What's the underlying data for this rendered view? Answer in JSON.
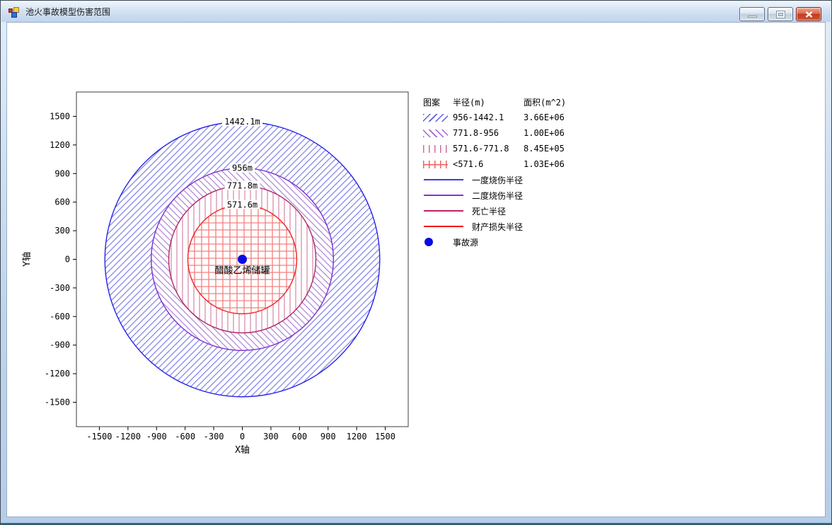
{
  "window": {
    "title": "池火事故模型伤害范围",
    "buttons": {
      "minimize": "minimize",
      "maximize": "maximize",
      "close": "close"
    }
  },
  "chart": {
    "x_axis": {
      "label": "X轴",
      "ticks": [
        -1500,
        -1200,
        -900,
        -600,
        -300,
        0,
        300,
        600,
        900,
        1200,
        1500
      ]
    },
    "y_axis": {
      "label": "Y轴",
      "ticks": [
        -1500,
        -1200,
        -900,
        -600,
        -300,
        0,
        300,
        600,
        900,
        1200,
        1500
      ]
    },
    "rings": [
      {
        "label": "1442.1m",
        "radius_m": 1442.1,
        "stroke": "#2525e8",
        "hatch": "diag-forward",
        "hatch_color": "#8585ea"
      },
      {
        "label": "956m",
        "radius_m": 956,
        "stroke": "#7c2fd0",
        "hatch": "diag-back",
        "hatch_color": "#b08ad6"
      },
      {
        "label": "771.8m",
        "radius_m": 771.8,
        "stroke": "#b02866",
        "hatch": "vertical",
        "hatch_color": "#d98fae"
      },
      {
        "label": "571.6m",
        "radius_m": 571.6,
        "stroke": "#ee2424",
        "hatch": "cross",
        "hatch_color": "#f28080"
      }
    ],
    "source": {
      "label": "醋酸乙烯储罐",
      "color": "#0a0ae6"
    }
  },
  "legend": {
    "headers": [
      "图案",
      "半径(m)",
      "面积(m^2)"
    ],
    "pattern_rows": [
      {
        "pattern": "diag-forward",
        "color": "#5c5ce2",
        "radius": "956-1442.1",
        "area": "3.66E+06"
      },
      {
        "pattern": "diag-back",
        "color": "#a263cc",
        "radius": "771.8-956",
        "area": "1.00E+06"
      },
      {
        "pattern": "vertical",
        "color": "#cf6f9e",
        "radius": "571.6-771.8",
        "area": "8.45E+05"
      },
      {
        "pattern": "cross",
        "color": "#ef6161",
        "radius": "<571.6",
        "area": "1.03E+06"
      }
    ],
    "line_rows": [
      {
        "color": "#3a3ae8",
        "label": "一度烧伤半径"
      },
      {
        "color": "#8833cc",
        "label": "二度烧伤半径"
      },
      {
        "color": "#c12069",
        "label": "死亡半径"
      },
      {
        "color": "#f21515",
        "label": "财产损失半径"
      }
    ],
    "source_row": {
      "color": "#0a0ae6",
      "label": "事故源"
    }
  },
  "chart_data": {
    "type": "area",
    "title": "池火事故模型伤害范围",
    "xlabel": "X轴",
    "ylabel": "Y轴",
    "xlim": [
      -1740,
      1740
    ],
    "ylim": [
      -1755,
      1755
    ],
    "x_ticks": [
      -1500,
      -1200,
      -900,
      -600,
      -300,
      0,
      300,
      600,
      900,
      1200,
      1500
    ],
    "y_ticks": [
      -1500,
      -1200,
      -900,
      -600,
      -300,
      0,
      300,
      600,
      900,
      1200,
      1500
    ],
    "grid": false,
    "legend_position": "right",
    "center": {
      "x": 0,
      "y": 0,
      "label": "醋酸乙烯储罐"
    },
    "rings": [
      {
        "name": "一度烧伤半径",
        "radius_m": 1442.1,
        "band_radius_m": "956-1442.1",
        "band_area_m2": "3.66E+06",
        "color": "#2525e8"
      },
      {
        "name": "二度烧伤半径",
        "radius_m": 956,
        "band_radius_m": "771.8-956",
        "band_area_m2": "1.00E+06",
        "color": "#7c2fd0"
      },
      {
        "name": "死亡半径",
        "radius_m": 771.8,
        "band_radius_m": "571.6-771.8",
        "band_area_m2": "8.45E+05",
        "color": "#b02866"
      },
      {
        "name": "财产损失半径",
        "radius_m": 571.6,
        "band_radius_m": "<571.6",
        "band_area_m2": "1.03E+06",
        "color": "#ee2424"
      }
    ],
    "accident_source": {
      "label": "事故源",
      "x": 0,
      "y": 0
    }
  }
}
